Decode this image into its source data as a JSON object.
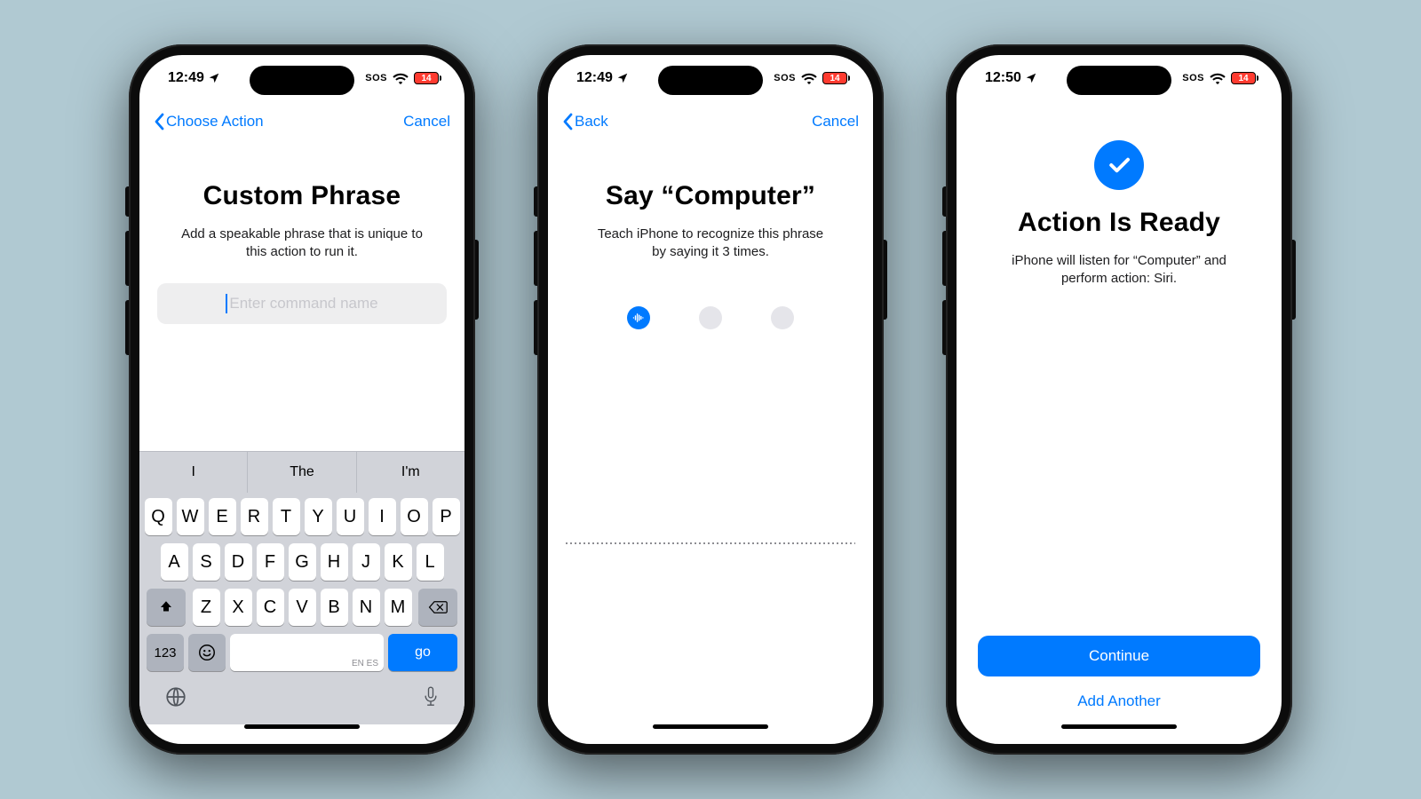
{
  "colors": {
    "accent": "#007AFF",
    "danger": "#FF3B30"
  },
  "phone1": {
    "status": {
      "time": "12:49",
      "sos": "SOS",
      "battery": "14"
    },
    "nav": {
      "back": "Choose Action",
      "cancel": "Cancel"
    },
    "title": "Custom Phrase",
    "subtitle": "Add a speakable phrase that is unique to this action to run it.",
    "field_placeholder": "Enter command name",
    "suggestions": [
      "I",
      "The",
      "I'm"
    ],
    "keyboard": {
      "row1": [
        "Q",
        "W",
        "E",
        "R",
        "T",
        "Y",
        "U",
        "I",
        "O",
        "P"
      ],
      "row2": [
        "A",
        "S",
        "D",
        "F",
        "G",
        "H",
        "J",
        "K",
        "L"
      ],
      "row3": [
        "Z",
        "X",
        "C",
        "V",
        "B",
        "N",
        "M"
      ],
      "numKey": "123",
      "space_hint": "EN ES",
      "go": "go"
    }
  },
  "phone2": {
    "status": {
      "time": "12:49",
      "sos": "SOS",
      "battery": "14"
    },
    "nav": {
      "back": "Back",
      "cancel": "Cancel"
    },
    "title": "Say “Computer”",
    "subtitle": "Teach iPhone to recognize this phrase by saying it 3 times.",
    "progress": {
      "total": 3,
      "active": 1
    }
  },
  "phone3": {
    "status": {
      "time": "12:50",
      "sos": "SOS",
      "battery": "14"
    },
    "title": "Action Is Ready",
    "subtitle": "iPhone will listen for “Computer” and perform action: Siri.",
    "continue": "Continue",
    "add_another": "Add Another"
  }
}
